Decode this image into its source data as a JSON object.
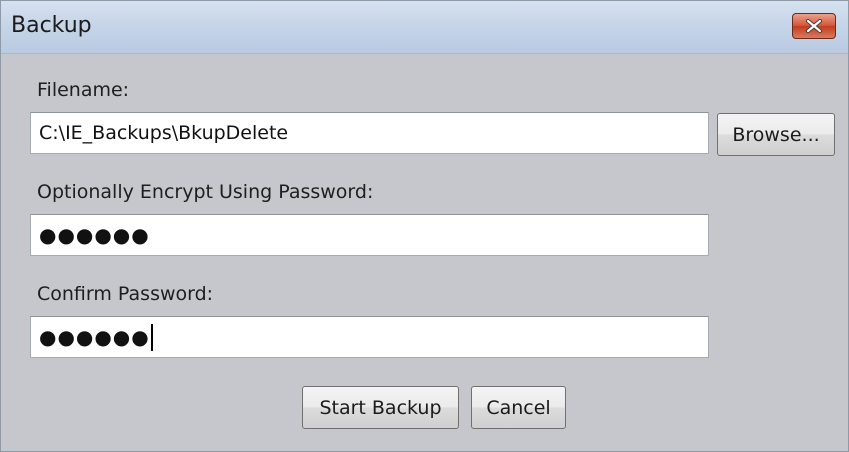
{
  "window": {
    "title": "Backup",
    "close_icon": "close-icon"
  },
  "filename": {
    "label": "Filename:",
    "value": "C:\\IE_Backups\\BkupDelete",
    "browse_label": "Browse..."
  },
  "password": {
    "label": "Optionally Encrypt Using Password:",
    "masked_value": "●●●●●●"
  },
  "confirm": {
    "label": "Confirm Password:",
    "masked_value": "●●●●●●"
  },
  "actions": {
    "start_label": "Start Backup",
    "cancel_label": "Cancel"
  }
}
